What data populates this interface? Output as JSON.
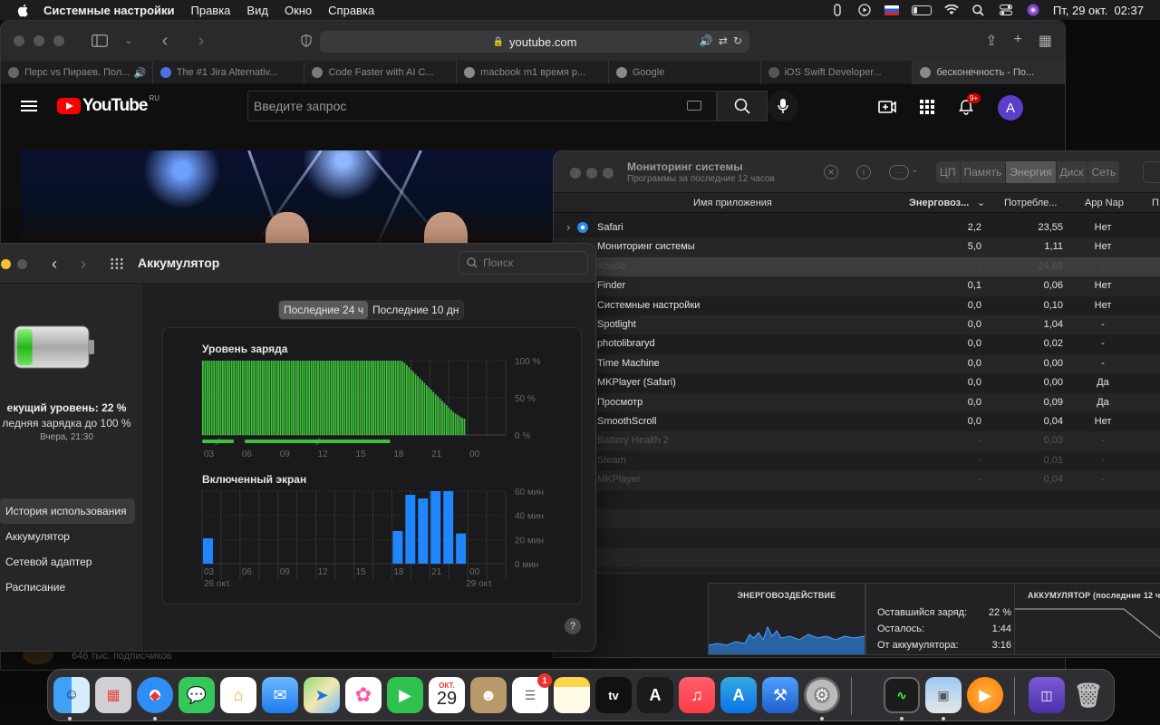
{
  "menubar": {
    "app_name": "Системные настройки",
    "menus": [
      "Правка",
      "Вид",
      "Окно",
      "Справка"
    ],
    "clock": "Пт, 29 окт.  02:37",
    "icons": [
      "apple-icon",
      "keyboard-layout-flag-ru",
      "battery-icon",
      "wifi-icon",
      "search-icon",
      "control-center-icon",
      "siri-icon"
    ]
  },
  "safari": {
    "address": "youtube.com",
    "tabs": [
      "Перс vs Пираев. Пол...",
      "The #1 Jira Alternativ...",
      "Code Faster with AI C...",
      "macbook m1 время р...",
      "Google",
      "iOS Swift Developer...",
      "бесконечность - По..."
    ],
    "youtube": {
      "logo_text": "YouTube",
      "region": "RU",
      "search_placeholder": "Введите запрос",
      "notifications_badge": "9+",
      "avatar_letter": "A",
      "subscribers": "646 тыс. подписчиков"
    }
  },
  "battery_prefs": {
    "title": "Аккумулятор",
    "search_placeholder": "Поиск",
    "current_level": "екущий уровень: 22 %",
    "last_charge": "ледняя зарядка до 100 %",
    "last_charge_time": "Вчера, 21:30",
    "sidebar": [
      "История использования",
      "Аккумулятор",
      "Сетевой адаптер",
      "Расписание"
    ],
    "range_tabs": [
      "Последние 24 ч",
      "Последние 10 дн"
    ],
    "charge_chart_title": "Уровень заряда",
    "screen_chart_title": "Включенный экран",
    "help": "?"
  },
  "chart_data": [
    {
      "type": "bar",
      "title": "Уровень заряда",
      "x_ticks": [
        "03",
        "06",
        "09",
        "12",
        "15",
        "18",
        "21",
        "00"
      ],
      "y_ticks": [
        "100 %",
        "50 %",
        "0 %"
      ],
      "ylim": [
        0,
        100
      ],
      "values": [
        100,
        100,
        100,
        100,
        100,
        100,
        100,
        100,
        100,
        100,
        100,
        100,
        100,
        100,
        100,
        100,
        100,
        100,
        100,
        100,
        100,
        100,
        100,
        100,
        100,
        100,
        100,
        100,
        100,
        100,
        100,
        100,
        100,
        100,
        100,
        100,
        100,
        100,
        100,
        100,
        100,
        100,
        100,
        100,
        100,
        100,
        100,
        100,
        100,
        100,
        100,
        100,
        100,
        100,
        100,
        100,
        100,
        100,
        100,
        100,
        100,
        100,
        100,
        100,
        100,
        100,
        100,
        100,
        100,
        100,
        100,
        100,
        100,
        100,
        100,
        100,
        100,
        100,
        100,
        100,
        100,
        100,
        100,
        100,
        100,
        100,
        100,
        100,
        100,
        100,
        99,
        97,
        94,
        91,
        88,
        85,
        82,
        79,
        76,
        73,
        70,
        67,
        64,
        61,
        58,
        55,
        52,
        49,
        46,
        43,
        40,
        37,
        34,
        31,
        29,
        27,
        25,
        23,
        22
      ],
      "charging_segments": [
        [
          0,
          10.5
        ],
        [
          14,
          62
        ]
      ],
      "charging_markers": [
        5,
        38
      ]
    },
    {
      "type": "bar",
      "title": "Включенный экран",
      "x_ticks": [
        "03",
        "06",
        "09",
        "12",
        "15",
        "18",
        "21",
        "00"
      ],
      "x_subticks": [
        "26 окт.",
        "29 окт."
      ],
      "y_ticks": [
        "60 мин",
        "40 мин",
        "20 мин",
        "0 мин"
      ],
      "ylim": [
        0,
        60
      ],
      "hours": [
        0,
        1,
        2,
        3,
        4,
        5,
        6,
        7,
        8,
        9,
        10,
        11,
        12,
        13,
        14,
        15,
        16,
        17,
        18,
        19,
        20,
        21,
        22,
        23
      ],
      "values": [
        0,
        0,
        0,
        21,
        0,
        0,
        0,
        0,
        0,
        0,
        0,
        0,
        0,
        0,
        0,
        0,
        0,
        0,
        27,
        57,
        54,
        60,
        60,
        25
      ]
    }
  ],
  "activity_monitor": {
    "title": "Мониторинг системы",
    "subtitle": "Программы за последние 12 часов",
    "tabs": [
      "ЦП",
      "Память",
      "Энергия",
      "Диск",
      "Сеть"
    ],
    "active_tab": "Энергия",
    "columns": [
      "Имя приложения",
      "Энерговоз...",
      "Потребле...",
      "App Nap",
      "П"
    ],
    "rows": [
      {
        "name": "Safari",
        "impact": "2,2",
        "usage": "23,55",
        "nap": "Нет",
        "style": "normal",
        "expand": true
      },
      {
        "name": "Мониторинг системы",
        "impact": "5,0",
        "usage": "1,11",
        "nap": "Нет",
        "style": "normal"
      },
      {
        "name": "Xcode",
        "impact": "-",
        "usage": "24,68",
        "nap": "-",
        "style": "dim"
      },
      {
        "name": "Finder",
        "impact": "0,1",
        "usage": "0,06",
        "nap": "Нет",
        "style": "normal"
      },
      {
        "name": "Системные настройки",
        "impact": "0,0",
        "usage": "0,10",
        "nap": "Нет",
        "style": "normal"
      },
      {
        "name": "Spotlight",
        "impact": "0,0",
        "usage": "1,04",
        "nap": "-",
        "style": "normal"
      },
      {
        "name": "photolibraryd",
        "impact": "0,0",
        "usage": "0,02",
        "nap": "-",
        "style": "normal"
      },
      {
        "name": "Time Machine",
        "impact": "0,0",
        "usage": "0,00",
        "nap": "-",
        "style": "normal"
      },
      {
        "name": "MKPlayer (Safari)",
        "impact": "0,0",
        "usage": "0,00",
        "nap": "Да",
        "style": "normal"
      },
      {
        "name": "Просмотр",
        "impact": "0,0",
        "usage": "0,09",
        "nap": "Да",
        "style": "normal"
      },
      {
        "name": "SmoothScroll",
        "impact": "0,0",
        "usage": "0,04",
        "nap": "Нет",
        "style": "normal"
      },
      {
        "name": "Battery Health 2",
        "impact": "-",
        "usage": "0,03",
        "nap": "-",
        "style": "dim"
      },
      {
        "name": "Steam",
        "impact": "-",
        "usage": "0,01",
        "nap": "-",
        "style": "dim"
      },
      {
        "name": "MKPlayer",
        "impact": "-",
        "usage": "0,04",
        "nap": "-",
        "style": "dim"
      }
    ],
    "energy_panel_title": "ЭНЕРГОВОЗДЕЙСТВИЕ",
    "battery_panel_title": "АККУМУЛЯТОР (последние 12 ч)",
    "stats": [
      {
        "label": "Оставшийся заряд:",
        "value": "22 %"
      },
      {
        "label": "Осталось:",
        "value": "1:44"
      },
      {
        "label": "От аккумулятора:",
        "value": "3:16"
      }
    ]
  },
  "dock": {
    "calendar_month": "ОКТ.",
    "calendar_day": "29",
    "reminders_badge": "1",
    "apps": [
      "Finder",
      "Launchpad",
      "Safari",
      "Сообщения",
      "Дом",
      "Почта",
      "Карты",
      "Фото",
      "FaceTime",
      "Календарь",
      "Контакты",
      "Напоминания",
      "Заметки",
      "TV",
      "Переводчик",
      "Музыка",
      "App Store",
      "Xcode",
      "Системные настройки",
      "Мониторинг системы",
      "Просмотр",
      "Infuse",
      "Утилита",
      "Корзина"
    ]
  }
}
